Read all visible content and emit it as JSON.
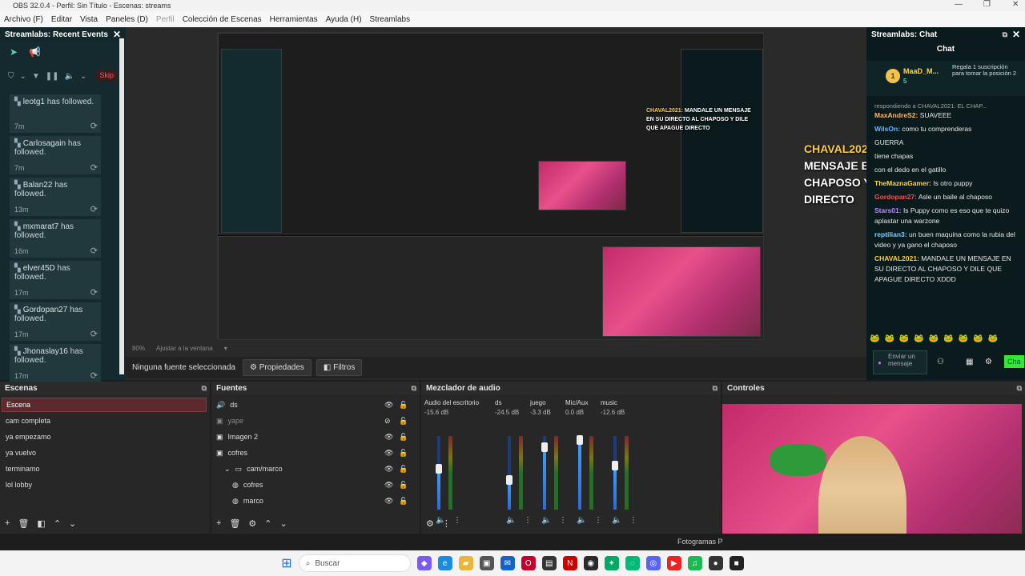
{
  "window": {
    "title": "OBS 32.0.4 - Perfil: Sin Título - Escenas: streams"
  },
  "menu": [
    {
      "label": "Archivo (F)"
    },
    {
      "label": "Editar"
    },
    {
      "label": "Vista"
    },
    {
      "label": "Paneles (D)"
    },
    {
      "label": "Perfil",
      "disabled": true
    },
    {
      "label": "Colección de Escenas"
    },
    {
      "label": "Herramientas"
    },
    {
      "label": "Ayuda (H)"
    },
    {
      "label": "Streamlabs"
    }
  ],
  "recent_events": {
    "title": "Streamlabs: Recent Events",
    "skip_label": "Skip",
    "items": [
      {
        "name": "leotg1",
        "action": "has followed.",
        "time": "7m"
      },
      {
        "name": "Carlosagain",
        "action": "has followed.",
        "time": "7m"
      },
      {
        "name": "Balan22",
        "action": "has followed.",
        "time": "13m"
      },
      {
        "name": "mxmarat7",
        "action": "has followed.",
        "time": "16m"
      },
      {
        "name": "elver45D",
        "action": "has followed.",
        "time": "17m"
      },
      {
        "name": "Gordopan27",
        "action": "has followed.",
        "time": "17m"
      },
      {
        "name": "Jhonaslay16",
        "action": "has followed.",
        "time": "17m"
      }
    ]
  },
  "preview": {
    "overlay_name": "CHAVAL2021:",
    "overlay_msg": "MANDALE UN MENSAJE EN SU DIRECTO AL CHAPOSO Y DILE QUE APAGUE DIRECTO",
    "zoom": "80%",
    "fit_label": "Ajustar a la ventana",
    "no_source": "Ninguna fuente seleccionada",
    "properties_label": "Propiedades",
    "filters_label": "Filtros"
  },
  "chat": {
    "title": "Streamlabs: Chat",
    "heading": "Chat",
    "top_user": "MaaD_M...",
    "top_count": "5",
    "top_gift": "Regala 1 suscripción para tomar la posición 2",
    "truncated": "respondiendo a CHAVAL2021: EL CHAP...",
    "messages": [
      {
        "user": "MaxAndreS2:",
        "text": "SUAVEEE",
        "color": "#ffb86b"
      },
      {
        "user": "WilsOn:",
        "text": "como tu comprenderas",
        "color": "#6ab7ff"
      },
      {
        "user": "",
        "text": "GUERRA",
        "color": "#ffffff"
      },
      {
        "user": "",
        "text": "tiene chapas",
        "color": "#ffffff"
      },
      {
        "user": "",
        "text": "con el dedo en el gatillo",
        "color": "#ffffff"
      },
      {
        "user": "TheMaznaGamer:",
        "text": "Is otro puppy",
        "color": "#ffd54a"
      },
      {
        "user": "Gordopan27:",
        "text": "Asle un baile al chaposo",
        "color": "#ff4d4d"
      },
      {
        "user": "Stars01:",
        "text": "Is Puppy como es eso que te quizo aplastar una warzone",
        "color": "#b98cff"
      },
      {
        "user": "reptilian3:",
        "text": "un buen maquina como la rubia del video y ya gano el chaposo",
        "color": "#7fd0ff"
      },
      {
        "user": "CHAVAL2021:",
        "text": "MANDALE UN MENSAJE EN SU DIRECTO AL CHAPOSO Y DILE QUE APAGUE DIRECTO XDDD",
        "color": "#ffcf3a"
      }
    ],
    "send_placeholder": "Enviar un mensaje",
    "chat_button": "Cha"
  },
  "scenes": {
    "title": "Escenas",
    "items": [
      "Escena",
      "cam completa",
      "ya empezamo",
      "ya vuelvo",
      "terminamo",
      "lol lobby"
    ]
  },
  "sources": {
    "title": "Fuentes",
    "items": [
      {
        "name": "ds",
        "icon": "speaker-icon",
        "indent": 0,
        "visible": true
      },
      {
        "name": "yape",
        "icon": "image-icon",
        "indent": 0,
        "visible": false
      },
      {
        "name": "Imagen 2",
        "icon": "image-icon",
        "indent": 0,
        "visible": true
      },
      {
        "name": "cofres",
        "icon": "image-icon",
        "indent": 0,
        "visible": true
      },
      {
        "name": "cam/marco",
        "icon": "folder-icon",
        "indent": 1,
        "visible": true
      },
      {
        "name": "cofres",
        "icon": "globe-icon",
        "indent": 2,
        "visible": true
      },
      {
        "name": "marco",
        "icon": "globe-icon",
        "indent": 2,
        "visible": true
      }
    ]
  },
  "mixer": {
    "title": "Mezclador de audio",
    "channels": [
      {
        "name": "Audio del escritorio",
        "db": "-15.6 dB",
        "level": 0.55
      },
      {
        "name": "ds",
        "db": "-24.5 dB",
        "level": 0.4
      },
      {
        "name": "juego",
        "db": "-3.3 dB",
        "level": 0.85
      },
      {
        "name": "Mic/Aux",
        "db": "0.0 dB",
        "level": 0.95
      },
      {
        "name": "music",
        "db": "-12.6 dB",
        "level": 0.6
      }
    ],
    "scale": [
      "-5",
      "-10",
      "-15",
      "-20",
      "-25",
      "-30",
      "-35",
      "-40",
      "-45",
      "-50",
      "-55",
      "-60"
    ]
  },
  "controls": {
    "title": "Controles"
  },
  "status": {
    "fotogramas": "Fotogramas P"
  },
  "taskbar": {
    "search_placeholder": "Buscar"
  }
}
